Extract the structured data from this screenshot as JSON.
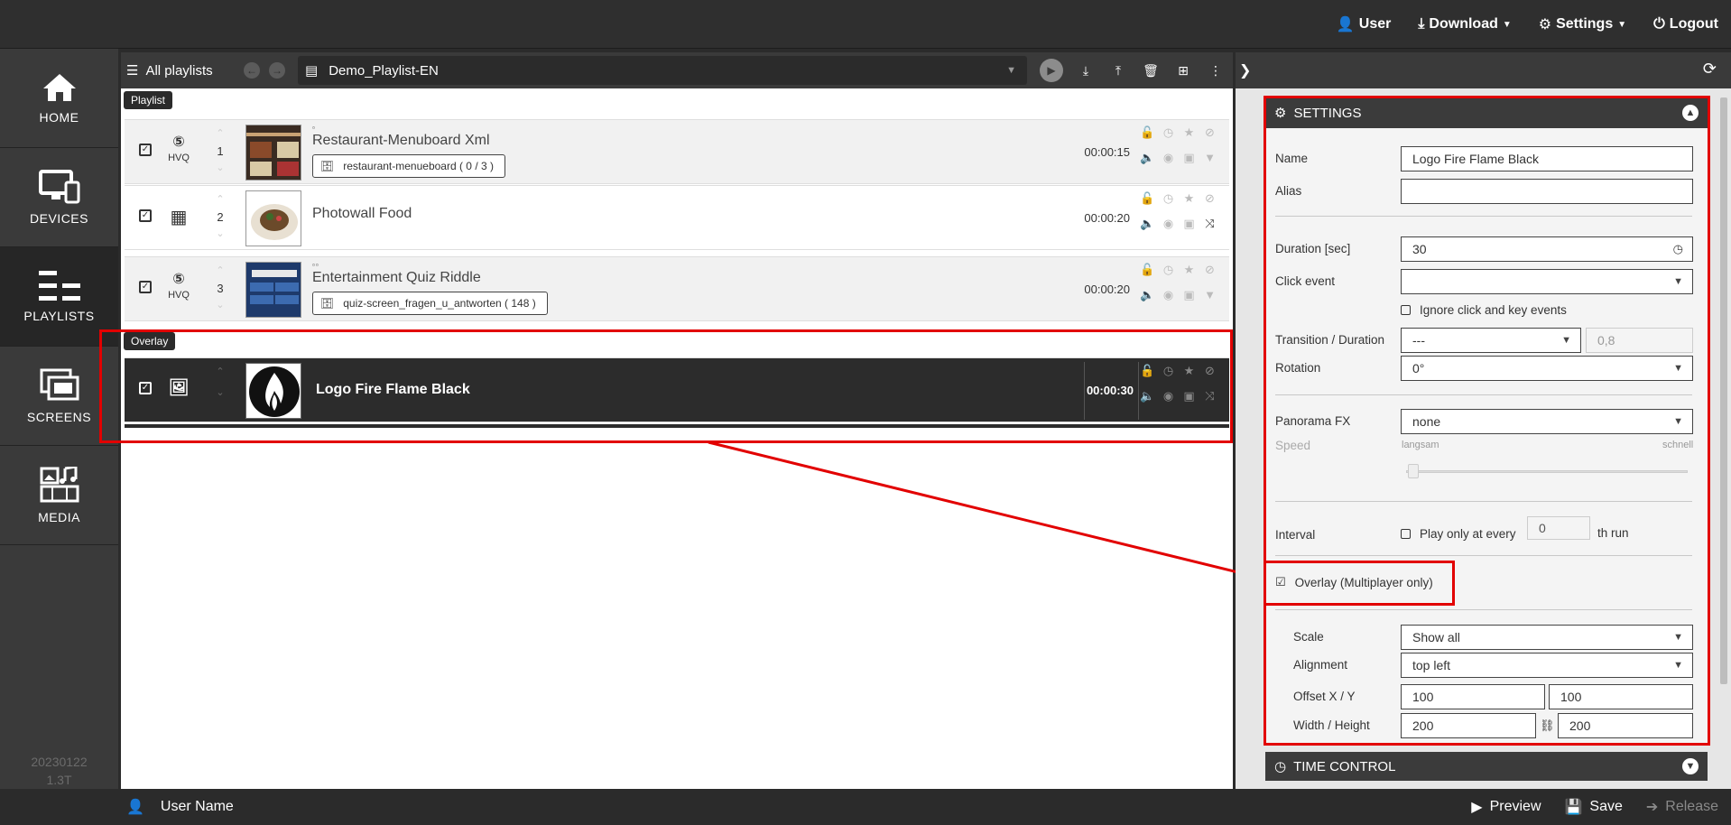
{
  "topnav": {
    "user": "User",
    "download": "Download",
    "settings": "Settings",
    "logout": "Logout"
  },
  "sidebar": {
    "items": [
      {
        "label": "HOME"
      },
      {
        "label": "DEVICES"
      },
      {
        "label": "PLAYLISTS",
        "active": true
      },
      {
        "label": "SCREENS"
      },
      {
        "label": "MEDIA"
      }
    ],
    "version_line1": "20230122",
    "version_line2": "1.3T"
  },
  "playlist_header": {
    "all_playlists": "All playlists",
    "selected_playlist": "Demo_Playlist-EN"
  },
  "sections": {
    "playlist": "Playlist",
    "overlay": "Overlay"
  },
  "playlist_rows": [
    {
      "order": "1",
      "type": "HTML5",
      "type_sub": "HVQ",
      "title": "Restaurant-Menuboard Xml",
      "tag": "restaurant-menueboard ( 0 / 3 )",
      "duration": "00:00:15"
    },
    {
      "order": "2",
      "type": "grid",
      "type_sub": "",
      "title": "Photowall Food",
      "tag": "",
      "duration": "00:00:20"
    },
    {
      "order": "3",
      "type": "HTML5",
      "type_sub": "HVQ",
      "title": "Entertainment Quiz Riddle",
      "tag": "quiz-screen_fragen_u_antworten ( 148 )",
      "duration": "00:00:20"
    }
  ],
  "overlay_row": {
    "type": "image",
    "title": "Logo Fire Flame Black",
    "duration": "00:00:30"
  },
  "settings": {
    "header": "SETTINGS",
    "name_label": "Name",
    "name_value": "Logo Fire Flame Black",
    "alias_label": "Alias",
    "alias_value": "",
    "duration_label": "Duration [sec]",
    "duration_value": "30",
    "click_event_label": "Click event",
    "click_event_value": "",
    "ignore_click_label": "Ignore click and key events",
    "transition_label": "Transition / Duration",
    "transition_value": "---",
    "transition_duration": "0,8",
    "rotation_label": "Rotation",
    "rotation_value": "0°",
    "panorama_label": "Panorama FX",
    "panorama_value": "none",
    "speed_label": "Speed",
    "speed_slow": "langsam",
    "speed_fast": "schnell",
    "interval_label": "Interval",
    "play_only_label": "Play only at every",
    "interval_value": "0",
    "th_run_label": "th run",
    "overlay_label": "Overlay (Multiplayer only)",
    "overlay_checked": true,
    "scale_label": "Scale",
    "scale_value": "Show all",
    "alignment_label": "Alignment",
    "alignment_value": "top left",
    "offset_label": "Offset X / Y",
    "offset_x": "100",
    "offset_y": "100",
    "size_label": "Width / Height",
    "width": "200",
    "height": "200"
  },
  "time_control": {
    "header": "TIME CONTROL"
  },
  "bottombar": {
    "user_name": "User Name",
    "preview": "Preview",
    "save": "Save",
    "release": "Release"
  },
  "colors": {
    "highlight": "#e20000",
    "dark": "#2c2c2c"
  }
}
